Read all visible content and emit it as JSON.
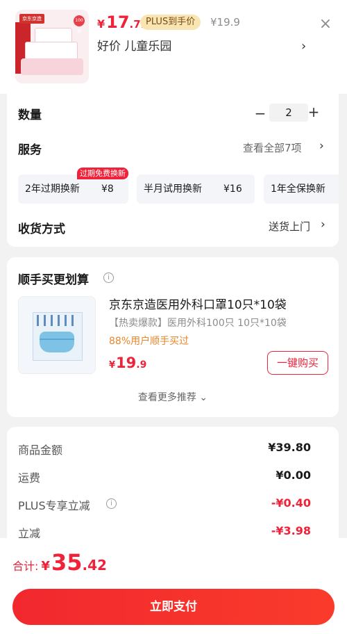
{
  "header": {
    "thumb_brand": "京东京造",
    "thumb_tag": "100抽",
    "price_yen": "¥",
    "price_int": "17",
    "price_dec": ".71",
    "plus_badge": "PLUS到手价",
    "orig_price": "¥19.9",
    "selected_sku": "好价  儿童乐园",
    "close_icon": "×",
    "chevron": "›"
  },
  "options": {
    "qty_label": "数量",
    "qty_minus": "−",
    "qty_value": "2",
    "qty_plus": "+",
    "service_label": "服务",
    "service_all": "查看全部7项",
    "chevron": "›",
    "service_chips": [
      {
        "name": "2年过期换新",
        "price": "¥8"
      },
      {
        "name": "半月试用换新",
        "price": "¥16"
      },
      {
        "name": "1年全保换新",
        "price": ""
      }
    ],
    "chip_tag": "过期免费换新",
    "delivery_label": "收货方式",
    "delivery_value": "送货上门"
  },
  "upsell": {
    "title": "顺手买更划算",
    "info_icon": "i",
    "product_name": "京东京造医用外科口罩10只*10袋",
    "product_desc": "【热卖爆款】医用外科100只 10只*10袋",
    "stat": "88%用户顺手买过",
    "price_yen": "¥",
    "price_int": "19",
    "price_dec": ".9",
    "buy_button": "一键购买",
    "more": "查看更多推荐 ⌄"
  },
  "summary": {
    "rows": [
      {
        "label": "商品金额",
        "value": "¥39.80"
      },
      {
        "label": "运费",
        "value": "¥0.00"
      },
      {
        "label": "PLUS专享立减",
        "value": "-¥0.40"
      },
      {
        "label": "立减",
        "value": "-¥3.98"
      }
    ],
    "info_icon": "i"
  },
  "footer": {
    "total_label": "合计:",
    "total_yen": "¥",
    "total_int": "35",
    "total_dec": ".42",
    "pay_button": "立即支付"
  },
  "colors": {
    "accent": "#f0223a",
    "plus_badge_bg": "#f9e5b2",
    "stat_orange": "#e8862a"
  }
}
